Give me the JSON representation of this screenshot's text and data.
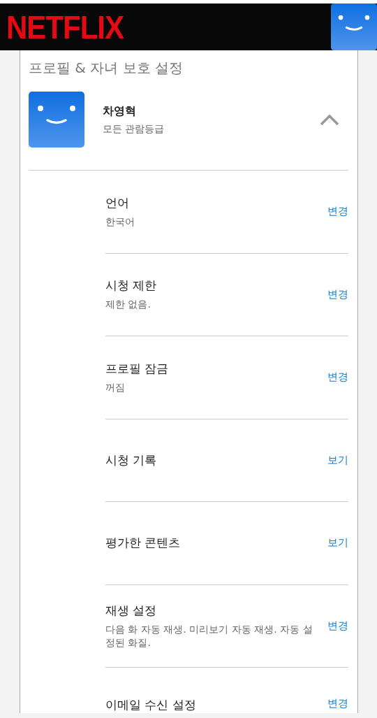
{
  "header": {
    "logo": "NETFLIX"
  },
  "page_title": "프로필 & 자녀 보호 설정",
  "profile": {
    "name": "차영혁",
    "rating": "모든 관람등급",
    "expanded": true
  },
  "settings": [
    {
      "title": "언어",
      "value": "한국어",
      "action": "변경"
    },
    {
      "title": "시청 제한",
      "value": "제한 없음.",
      "action": "변경"
    },
    {
      "title": "프로필 잠금",
      "value": "꺼짐",
      "action": "변경"
    },
    {
      "title": "시청 기록",
      "action": "보기"
    },
    {
      "title": "평가한 콘텐츠",
      "action": "보기"
    },
    {
      "title": "재생 설정",
      "value": "다음 화 자동 재생. 미리보기 자동 재생. 자동 설정된 화질.",
      "action": "변경"
    },
    {
      "title": "이메일 수신 설정",
      "action": "변경"
    }
  ]
}
